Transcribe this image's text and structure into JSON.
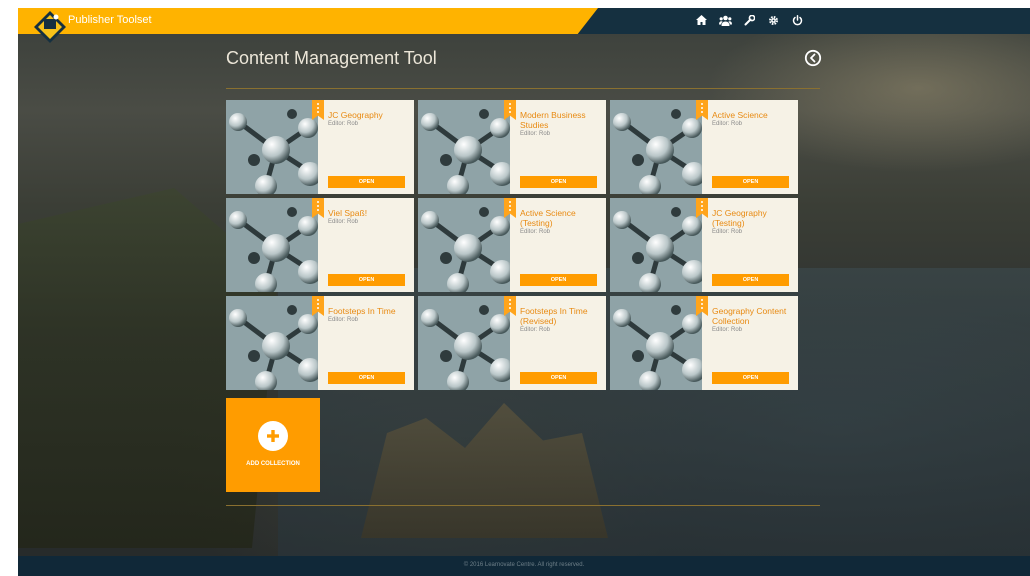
{
  "header": {
    "brand": "Publisher Toolset",
    "icons": [
      "home-icon",
      "users-icon",
      "wrench-icon",
      "gear-icon",
      "power-icon"
    ]
  },
  "page": {
    "title": "Content Management Tool",
    "back_icon": "chevron-left-circle-icon"
  },
  "collections": [
    {
      "title": "JC Geography",
      "editor": "Editor: Rob",
      "open_label": "OPEN"
    },
    {
      "title": "Modern Business Studies",
      "editor": "Editor: Rob",
      "open_label": "OPEN"
    },
    {
      "title": "Active Science",
      "editor": "Editor: Rob",
      "open_label": "OPEN"
    },
    {
      "title": "Viel Spaß!",
      "editor": "Editor: Rob",
      "open_label": "OPEN"
    },
    {
      "title": "Active Science (Testing)",
      "editor": "Editor: Rob",
      "open_label": "OPEN"
    },
    {
      "title": "JC Geography (Testing)",
      "editor": "Editor: Rob",
      "open_label": "OPEN"
    },
    {
      "title": "Footsteps In Time",
      "editor": "Editor: Rob",
      "open_label": "OPEN"
    },
    {
      "title": "Footsteps In Time (Revised)",
      "editor": "Editor: Rob",
      "open_label": "OPEN"
    },
    {
      "title": "Geography Content Collection",
      "editor": "Editor: Rob",
      "open_label": "OPEN"
    }
  ],
  "add_collection": {
    "label": "ADD COLLECTION",
    "icon": "plus-icon"
  },
  "footer": {
    "text": "© 2016 Learnovate Centre. All right reserved."
  },
  "colors": {
    "brand": "#ffb300",
    "accent": "#ff9c00",
    "nav": "#153040",
    "card_title": "#e88a12"
  }
}
